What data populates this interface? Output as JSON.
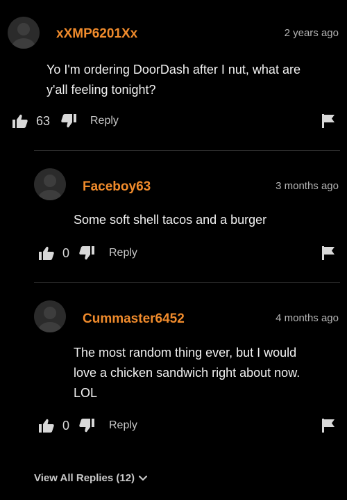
{
  "comments": [
    {
      "username": "xXMP6201Xx",
      "time": "2 years ago",
      "text_lines": [
        "Yo I'm ordering DoorDash after I nut, what are",
        "y'all feeling tonight?"
      ],
      "likes": "63",
      "reply_label": "Reply"
    },
    {
      "username": "Faceboy63",
      "time": "3 months ago",
      "text_lines": [
        "Some soft shell tacos and a burger"
      ],
      "likes": "0",
      "reply_label": "Reply"
    },
    {
      "username": "Cummaster6452",
      "time": "4 months ago",
      "text_lines": [
        "The most random thing ever, but I would",
        "love a chicken sandwich right about now.",
        "LOL"
      ],
      "likes": "0",
      "reply_label": "Reply"
    }
  ],
  "view_all_label": "View All Replies (12)",
  "colors": {
    "background": "#000000",
    "username": "#f08b2c",
    "text": "#f2f2f2",
    "muted": "#b5b5b5"
  }
}
